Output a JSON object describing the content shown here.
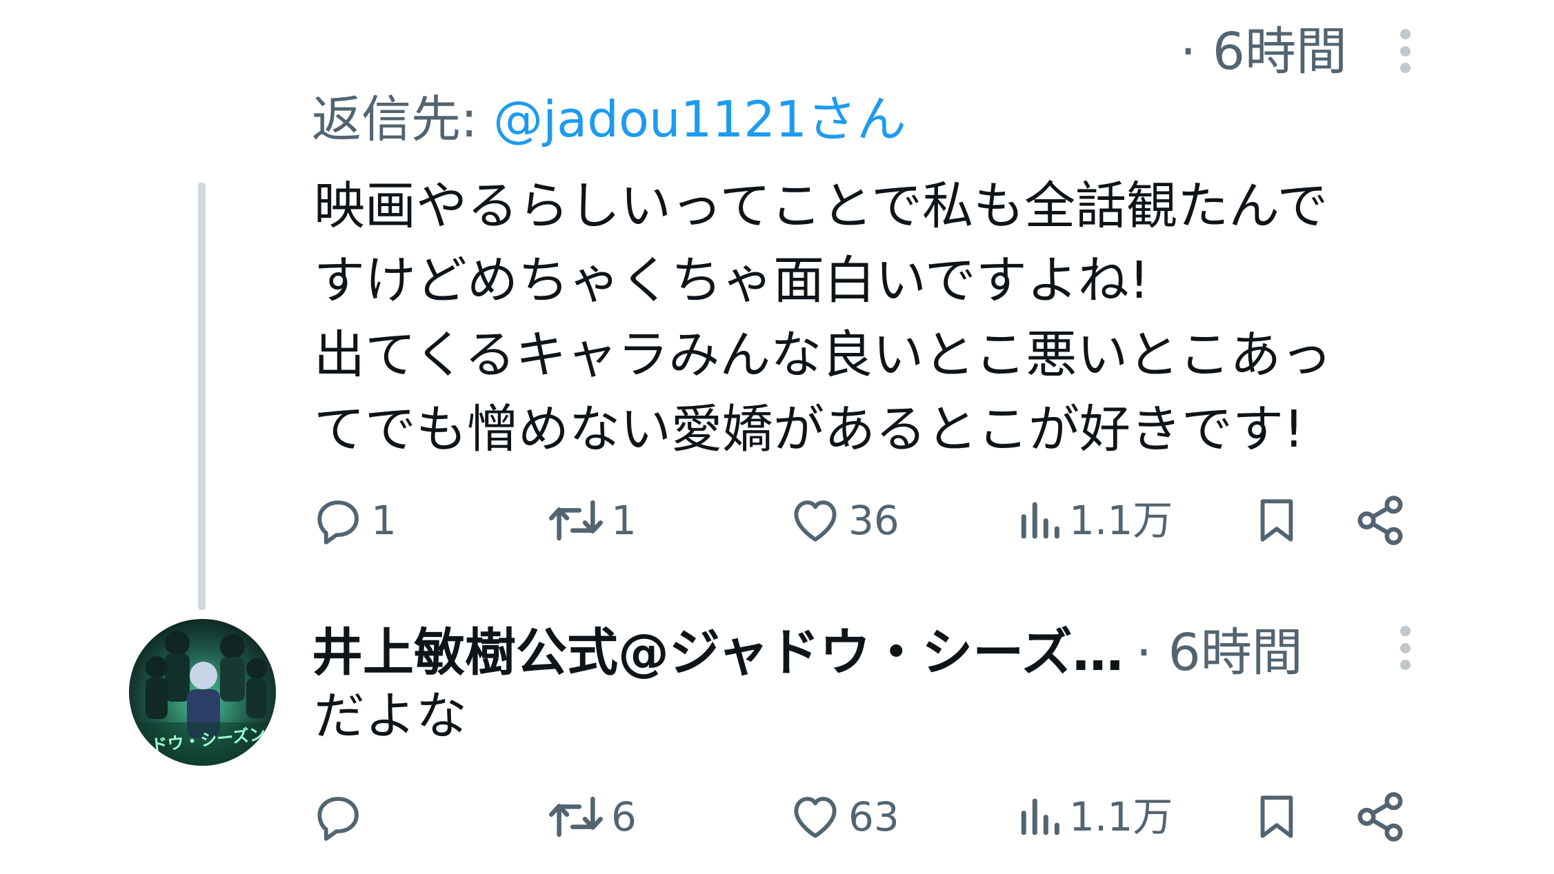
{
  "tweet1": {
    "time": "· 6時間",
    "replying_label": "返信先: ",
    "replying_handle": "@jadou1121さん",
    "body": "映画やるらしいってことで私も全話観たんで\nすけどめちゃくちゃ面白いですよね!\n出てくるキャラみんな良いとこ悪いとこあっ\nてでも憎めない愛嬌があるとこが好きです!",
    "reply_count": "1",
    "retweet_count": "1",
    "like_count": "36",
    "view_count": "1.1万"
  },
  "tweet2": {
    "display_name": "井上敏樹公式@ジャドウ・シーズ…",
    "time": "· 6時間",
    "body": "だよな",
    "avatar_text": "ャドウ・シーズン",
    "reply_count": "",
    "retweet_count": "6",
    "like_count": "63",
    "view_count": "1.1万"
  },
  "icons": {
    "reply": "reply-icon",
    "retweet": "retweet-icon",
    "like": "heart-icon",
    "views": "views-icon",
    "bookmark": "bookmark-icon",
    "share": "share-icon",
    "more": "more-vertical-icon"
  },
  "colors": {
    "text": "#0f1419",
    "secondary": "#536471",
    "link": "#1d9bf0",
    "thread_line": "#cfd9de"
  }
}
